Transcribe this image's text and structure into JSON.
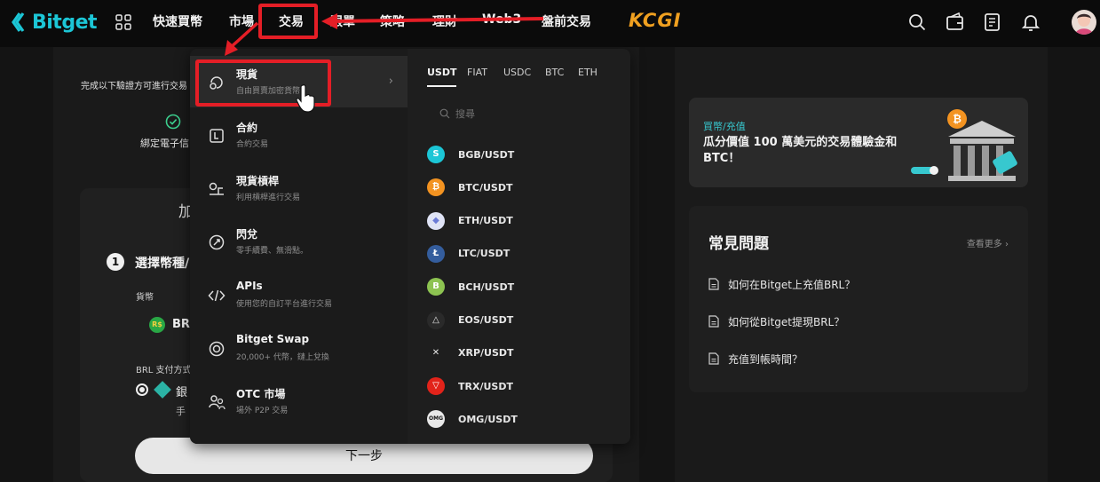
{
  "brand": {
    "name": "Bitget",
    "accent": "#1cc6d6"
  },
  "nav": {
    "items": [
      "快速買幣",
      "市場",
      "交易",
      "跟單",
      "策略",
      "理財",
      "Web3",
      "盤前交易"
    ],
    "partner_logo": "KCGI"
  },
  "background": {
    "verify_hint": "完成以下驗證方可進行交易",
    "bind_label": "綁定電子信",
    "panel_heading": "加",
    "step_number": "1",
    "step_title": "選擇幣種/",
    "currency_label": "貨幣",
    "currency_coin": "R$",
    "currency_value": "BR",
    "payment_label": "BRL 支付方式",
    "payment_method": "銀",
    "payment_sub": "手",
    "next_button": "下一步"
  },
  "dropdown": {
    "menu": [
      {
        "title": "現貨",
        "subtitle": "自由買賣加密貨幣",
        "icon": "spot-icon",
        "chevron": "›"
      },
      {
        "title": "合約",
        "subtitle": "合約交易",
        "icon": "futures-icon"
      },
      {
        "title": "現貨槓桿",
        "subtitle": "利用槓桿進行交易",
        "icon": "margin-icon"
      },
      {
        "title": "閃兌",
        "subtitle": "零手續費、無滑點。",
        "icon": "convert-icon"
      },
      {
        "title": "APIs",
        "subtitle": "使用您的自訂平台進行交易",
        "icon": "api-icon"
      },
      {
        "title": "Bitget Swap",
        "subtitle": "20,000+ 代幣，鏈上兌換",
        "icon": "swap-icon"
      },
      {
        "title": "OTC 市場",
        "subtitle": "場外 P2P 交易",
        "icon": "otc-icon"
      }
    ],
    "quote_tabs": [
      "USDT",
      "FIAT",
      "USDC",
      "BTC",
      "ETH"
    ],
    "active_quote": "USDT",
    "search_placeholder": "搜尋",
    "pairs": [
      {
        "label": "BGB/USDT",
        "coin": "bgb-coin",
        "color": "#1cc6d6",
        "glyph": "S"
      },
      {
        "label": "BTC/USDT",
        "coin": "btc-coin",
        "color": "#f39321",
        "glyph": "₿"
      },
      {
        "label": "ETH/USDT",
        "coin": "eth-coin",
        "color": "#dfe3f5",
        "glyph": "◆"
      },
      {
        "label": "LTC/USDT",
        "coin": "ltc-coin",
        "color": "#345d9d",
        "glyph": "Ł"
      },
      {
        "label": "BCH/USDT",
        "coin": "bch-coin",
        "color": "#8dc351",
        "glyph": "B"
      },
      {
        "label": "EOS/USDT",
        "coin": "eos-coin",
        "color": "#2a2a2a",
        "glyph": "△"
      },
      {
        "label": "XRP/USDT",
        "coin": "xrp-coin",
        "color": "#1e1e1e",
        "glyph": "✕"
      },
      {
        "label": "TRX/USDT",
        "coin": "trx-coin",
        "color": "#e2231a",
        "glyph": "▽"
      },
      {
        "label": "OMG/USDT",
        "coin": "omg-coin",
        "color": "#e8e8e8",
        "glyph": "OMG"
      }
    ]
  },
  "promo": {
    "tag": "買幣/充值",
    "text": "瓜分價值 100 萬美元的交易體驗金和 BTC！"
  },
  "faq": {
    "title": "常見問題",
    "more": "查看更多 ›",
    "items": [
      "如何在Bitget上充值BRL？",
      "如何從Bitget提現BRL？",
      "充值到帳時間？"
    ]
  },
  "annotation_color": "#e41e26"
}
